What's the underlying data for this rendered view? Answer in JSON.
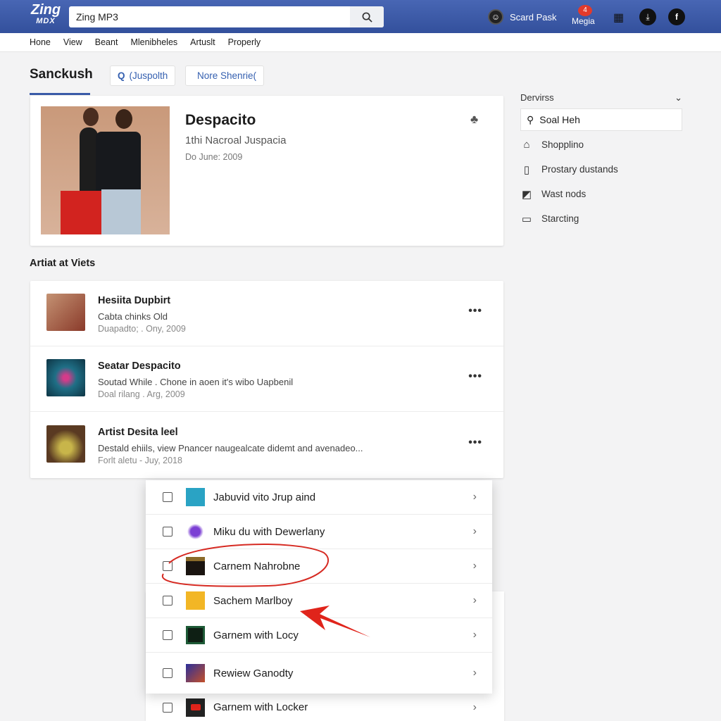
{
  "header": {
    "logo_top": "Zing",
    "logo_bottom": "MDX",
    "search_value": "Zing MP3",
    "account_label": "Scard Pask",
    "media_label": "Megia",
    "media_badge": "4",
    "icons": [
      "search-icon",
      "account-icon",
      "media-icon",
      "grid-icon",
      "download-icon",
      "facebook-icon"
    ],
    "bg_color": "#3a5ba8"
  },
  "nav": [
    "Hone",
    "View",
    "Beant",
    "Mlenibheles",
    "Artuslt",
    "Properly"
  ],
  "page": {
    "title": "Sanckush",
    "chips": [
      {
        "icon": "search-icon",
        "label": "(Juspolth"
      },
      {
        "icon": "apple-icon",
        "label": "Nore Shenrie("
      }
    ]
  },
  "hero": {
    "title": "Despacito",
    "subtitle": "1thi Nacroal Juspacia",
    "date": "Do June: 2009"
  },
  "section": {
    "title": "Artiat at Viets"
  },
  "list": [
    {
      "title": "Hesiita Dupbirt",
      "subtitle": "Cabta chinks Old",
      "date": "Duapadto; . Ony, 2009"
    },
    {
      "title": "Seatar Despacito",
      "subtitle": "Soutad While . Chone in aoen it's wibo Uapbenil",
      "date": "Doal rilang . Arg, 2009"
    },
    {
      "title": "Artist Desita leel",
      "subtitle": "Destald ehiils, view Pnancer naugealcate didemt and avenadeo...",
      "date": "Forlt aletu - Juy, 2018"
    }
  ],
  "sidebar": {
    "title": "Dervirss",
    "search_value": "Soal Heh",
    "items": [
      {
        "icon": "home-icon",
        "label": "Shopplino"
      },
      {
        "icon": "phone-icon",
        "label": "Prostary dustands"
      },
      {
        "icon": "image-icon",
        "label": "Wast nods"
      },
      {
        "icon": "layout-icon",
        "label": "Starcting"
      }
    ]
  },
  "popup": {
    "items": [
      "Jabuvid vito Jrup aind",
      "Miku du with Dewerlany",
      "Carnem Nahrobne",
      "Sachem Marlboy",
      "Garnem with Locy",
      "Rewiew Ganodty"
    ],
    "highlighted": "Carnem Nahrobne",
    "annotation_color": "#e0241b"
  },
  "below_popup": {
    "label": "Garnem with Locker"
  }
}
